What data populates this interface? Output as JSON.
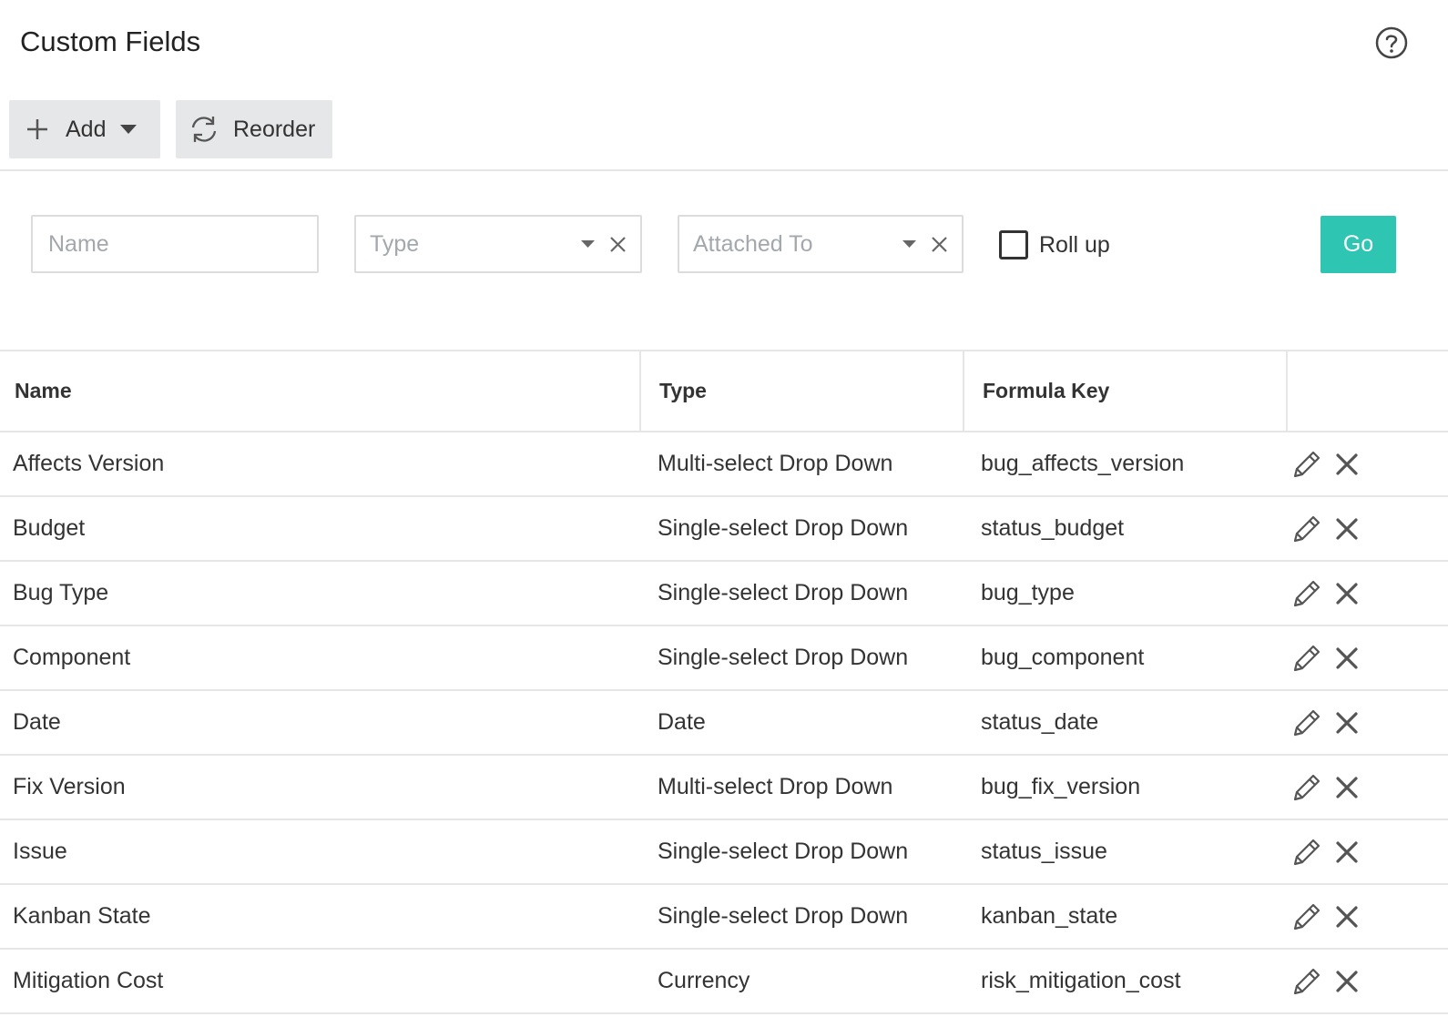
{
  "header": {
    "title": "Custom Fields",
    "help_icon": "question-circle-icon"
  },
  "toolbar": {
    "add_label": "Add",
    "reorder_label": "Reorder"
  },
  "filters": {
    "name_placeholder": "Name",
    "type_placeholder": "Type",
    "attached_placeholder": "Attached To",
    "rollup_label": "Roll up",
    "rollup_checked": false,
    "go_label": "Go",
    "go_color": "#2fc5b3"
  },
  "table": {
    "columns": [
      "Name",
      "Type",
      "Formula Key",
      ""
    ],
    "rows": [
      {
        "name": "Affects Version",
        "type": "Multi-select Drop Down",
        "key": "bug_affects_version"
      },
      {
        "name": "Budget",
        "type": "Single-select Drop Down",
        "key": "status_budget"
      },
      {
        "name": "Bug Type",
        "type": "Single-select Drop Down",
        "key": "bug_type"
      },
      {
        "name": "Component",
        "type": "Single-select Drop Down",
        "key": "bug_component"
      },
      {
        "name": "Date",
        "type": "Date",
        "key": "status_date"
      },
      {
        "name": "Fix Version",
        "type": "Multi-select Drop Down",
        "key": "bug_fix_version"
      },
      {
        "name": "Issue",
        "type": "Single-select Drop Down",
        "key": "status_issue"
      },
      {
        "name": "Kanban State",
        "type": "Single-select Drop Down",
        "key": "kanban_state"
      },
      {
        "name": "Mitigation Cost",
        "type": "Currency",
        "key": "risk_mitigation_cost"
      }
    ]
  }
}
